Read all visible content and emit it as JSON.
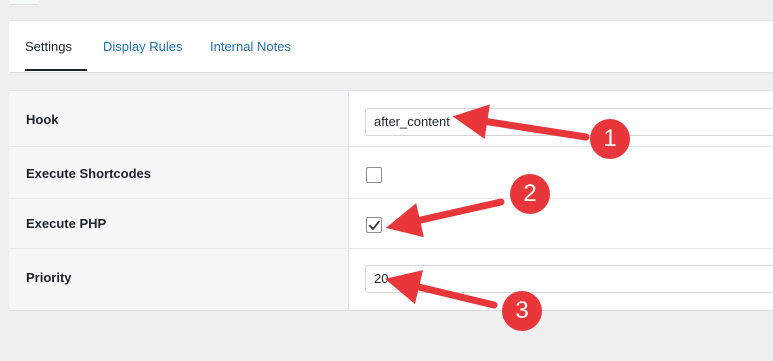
{
  "tabs": [
    {
      "label": "Settings"
    },
    {
      "label": "Display Rules"
    },
    {
      "label": "Internal Notes"
    }
  ],
  "rows": {
    "hook": {
      "label": "Hook",
      "value": "after_content"
    },
    "shortcodes": {
      "label": "Execute Shortcodes",
      "checked": false
    },
    "php": {
      "label": "Execute PHP",
      "checked": true
    },
    "priority": {
      "label": "Priority",
      "value": "20"
    }
  },
  "annotations": [
    {
      "number": "1"
    },
    {
      "number": "2"
    },
    {
      "number": "3"
    }
  ],
  "colors": {
    "accent_link": "#2271b1",
    "annotation_red": "#e8363a",
    "panel_bg": "#f0f0f1",
    "label_col_bg": "#f6f7f7"
  }
}
